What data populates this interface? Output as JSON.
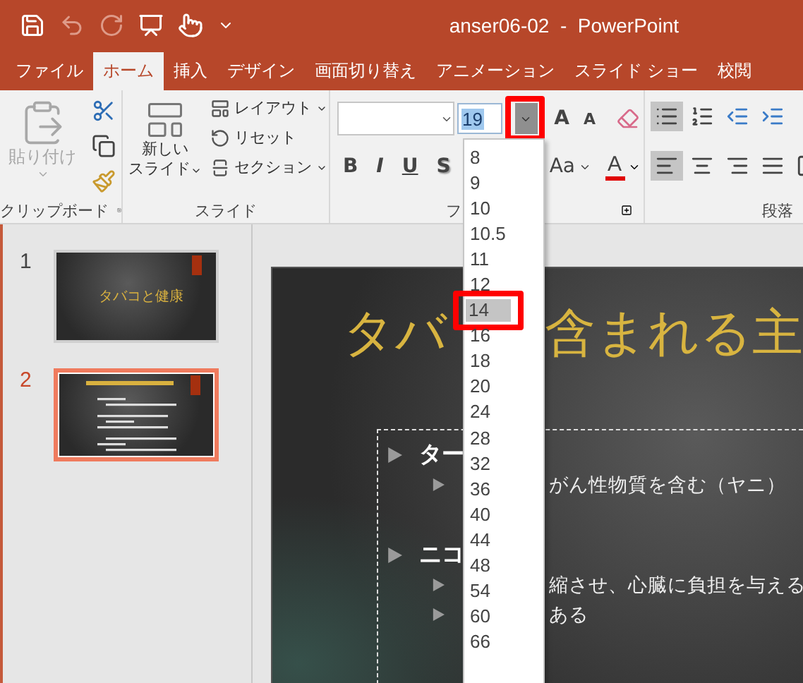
{
  "window": {
    "title": "anser06-02  -  PowerPoint"
  },
  "quick_access": [
    {
      "kind": "save",
      "disabled": false
    },
    {
      "kind": "undo",
      "disabled": true
    },
    {
      "kind": "redo",
      "disabled": true
    },
    {
      "kind": "present",
      "disabled": false
    },
    {
      "kind": "touch",
      "disabled": false
    },
    {
      "kind": "customize",
      "disabled": false
    }
  ],
  "tabs": [
    {
      "label": "ファイル",
      "selected": false
    },
    {
      "label": "ホーム",
      "selected": true
    },
    {
      "label": "挿入",
      "selected": false
    },
    {
      "label": "デザイン",
      "selected": false
    },
    {
      "label": "画面切り替え",
      "selected": false
    },
    {
      "label": "アニメーション",
      "selected": false
    },
    {
      "label": "スライド ショー",
      "selected": false
    },
    {
      "label": "校閲",
      "selected": false
    }
  ],
  "clipboard": {
    "label": "クリップボード",
    "paste": {
      "label": "貼り付け",
      "disabled": true
    }
  },
  "slides_group": {
    "label": "スライド",
    "new_slide": [
      "新しい",
      "スライド"
    ],
    "buttons": [
      {
        "kind": "layout",
        "label": "レイアウト",
        "dropdown": true
      },
      {
        "kind": "reset",
        "label": "リセット",
        "dropdown": false
      },
      {
        "kind": "section",
        "label": "セクション",
        "dropdown": true
      }
    ]
  },
  "font": {
    "label": "フ",
    "font_size": "19",
    "size_open": true,
    "size_marked": true,
    "grow": "A",
    "shrink": "A",
    "styles": [
      "B",
      "I",
      "U",
      "S"
    ],
    "change_case": "Aa",
    "font_color": "A",
    "size_list": [
      {
        "label": "8",
        "selected": false,
        "marked": false
      },
      {
        "label": "9",
        "selected": false,
        "marked": false
      },
      {
        "label": "10",
        "selected": false,
        "marked": false
      },
      {
        "label": "10.5",
        "selected": false,
        "marked": false
      },
      {
        "label": "11",
        "selected": false,
        "marked": false
      },
      {
        "label": "12",
        "selected": false,
        "marked": false
      },
      {
        "label": "14",
        "selected": true,
        "marked": true
      },
      {
        "label": "16",
        "selected": false,
        "marked": false
      },
      {
        "label": "18",
        "selected": false,
        "marked": false
      },
      {
        "label": "20",
        "selected": false,
        "marked": false
      },
      {
        "label": "24",
        "selected": false,
        "marked": false
      },
      {
        "label": "28",
        "selected": false,
        "marked": false
      },
      {
        "label": "32",
        "selected": false,
        "marked": false
      },
      {
        "label": "36",
        "selected": false,
        "marked": false
      },
      {
        "label": "40",
        "selected": false,
        "marked": false
      },
      {
        "label": "44",
        "selected": false,
        "marked": false
      },
      {
        "label": "48",
        "selected": false,
        "marked": false
      },
      {
        "label": "54",
        "selected": false,
        "marked": false
      },
      {
        "label": "60",
        "selected": false,
        "marked": false
      },
      {
        "label": "66",
        "selected": false,
        "marked": false
      }
    ]
  },
  "paragraph": {
    "label": "段落",
    "lists": [
      {
        "kind": "bullets",
        "selected": true
      },
      {
        "kind": "numbering",
        "selected": false
      },
      {
        "kind": "outdent",
        "selected": false
      },
      {
        "kind": "indent",
        "selected": false
      }
    ],
    "alignments": [
      {
        "kind": "left",
        "selected": true
      },
      {
        "kind": "center",
        "selected": false
      },
      {
        "kind": "right",
        "selected": false
      },
      {
        "kind": "justify",
        "selected": false
      },
      {
        "kind": "columns",
        "selected": false
      }
    ]
  },
  "thumbnails": [
    {
      "number": "1",
      "selected": false,
      "title": "タバコと健康"
    },
    {
      "number": "2",
      "selected": true
    }
  ],
  "slide": {
    "title_left": "タバ",
    "title_right": "含まれる主",
    "bullets": [
      {
        "text": "ター",
        "children": [
          {
            "text": "がん性物質を含む（ヤニ）"
          }
        ]
      },
      {
        "text": "ニコ",
        "children": [
          {
            "text": "縮させ、心臓に負担を与える"
          },
          {
            "text": "ある"
          }
        ]
      }
    ]
  }
}
